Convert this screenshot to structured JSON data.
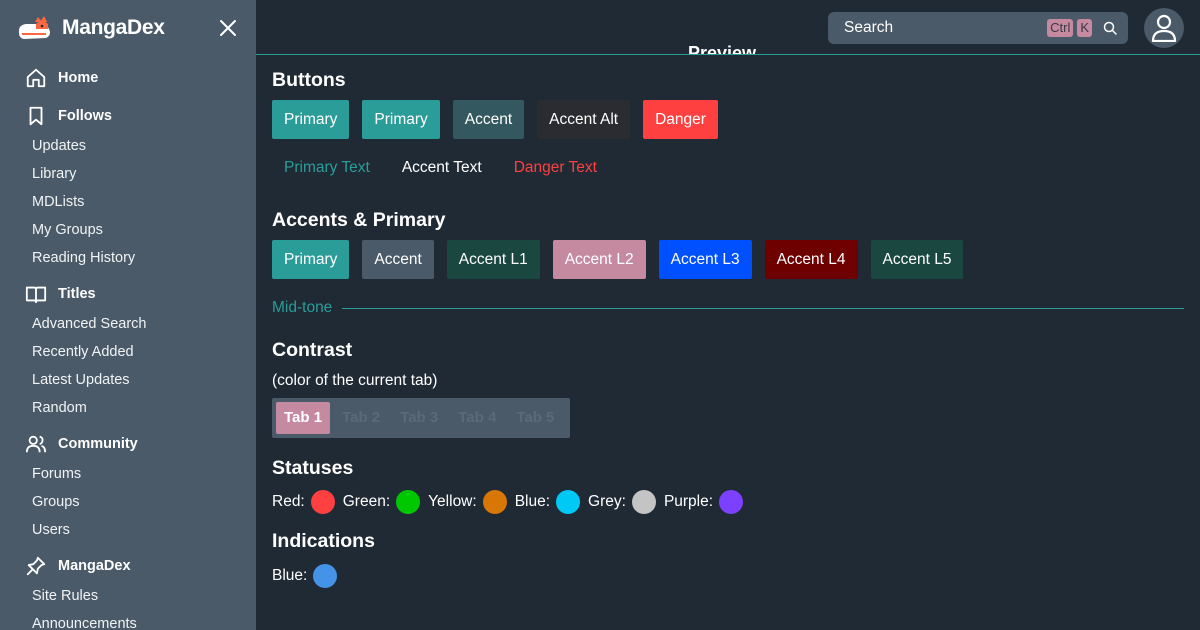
{
  "brand": {
    "name": "MangaDex",
    "logo_icon": "mangadex-cat-logo",
    "logo_color": "#ff6740"
  },
  "sidebar": {
    "sections": [
      {
        "label": "Home",
        "icon": "home-icon",
        "items": []
      },
      {
        "label": "Follows",
        "icon": "bookmark-icon",
        "items": [
          "Updates",
          "Library",
          "MDLists",
          "My Groups",
          "Reading History"
        ]
      },
      {
        "label": "Titles",
        "icon": "book-open-icon",
        "items": [
          "Advanced Search",
          "Recently Added",
          "Latest Updates",
          "Random"
        ]
      },
      {
        "label": "Community",
        "icon": "users-icon",
        "items": [
          "Forums",
          "Groups",
          "Users"
        ]
      },
      {
        "label": "MangaDex",
        "icon": "pin-icon",
        "items": [
          "Site Rules",
          "Announcements"
        ]
      }
    ]
  },
  "header": {
    "search_placeholder": "Search",
    "shortcut_ctrl": "Ctrl",
    "shortcut_key": "K"
  },
  "preview_title": "Preview",
  "sections": {
    "buttons_title": "Buttons",
    "buttons": [
      {
        "label": "Primary",
        "color": "#2a9d99"
      },
      {
        "label": "Primary",
        "color": "#2a9d99"
      },
      {
        "label": "Accent",
        "color": "#34585f"
      },
      {
        "label": "Accent Alt",
        "color": "#2a2c31"
      },
      {
        "label": "Danger",
        "color": "#ff4040"
      }
    ],
    "text_buttons": [
      {
        "label": "Primary Text",
        "color": "#2a9d99"
      },
      {
        "label": "Accent Text",
        "color": "#ffffff"
      },
      {
        "label": "Danger Text",
        "color": "#ff4040"
      }
    ],
    "accents_title": "Accents & Primary",
    "accents": [
      {
        "label": "Primary",
        "color": "#2a9d99"
      },
      {
        "label": "Accent",
        "color": "#4a5a68"
      },
      {
        "label": "Accent L1",
        "color": "#1a4840"
      },
      {
        "label": "Accent L2",
        "color": "#c58aa0"
      },
      {
        "label": "Accent L3",
        "color": "#0050ff"
      },
      {
        "label": "Accent L4",
        "color": "#6e0000"
      },
      {
        "label": "Accent L5",
        "color": "#1a4840"
      }
    ],
    "midtone_label": "Mid-tone",
    "contrast_title": "Contrast",
    "contrast_sub": "(color of the current tab)",
    "tabs": [
      "Tab 1",
      "Tab 2",
      "Tab 3",
      "Tab 4",
      "Tab 5"
    ],
    "active_tab": 0,
    "statuses_title": "Statuses",
    "statuses": [
      {
        "label": "Red:",
        "color": "#ff4040"
      },
      {
        "label": "Green:",
        "color": "#00c800"
      },
      {
        "label": "Yellow:",
        "color": "#d97706"
      },
      {
        "label": "Blue:",
        "color": "#00c9f5"
      },
      {
        "label": "Grey:",
        "color": "#c4c4c4"
      },
      {
        "label": "Purple:",
        "color": "#7c40ff"
      }
    ],
    "indications_title": "Indications",
    "indications": [
      {
        "label": "Blue:",
        "color": "#4593e9"
      }
    ]
  }
}
